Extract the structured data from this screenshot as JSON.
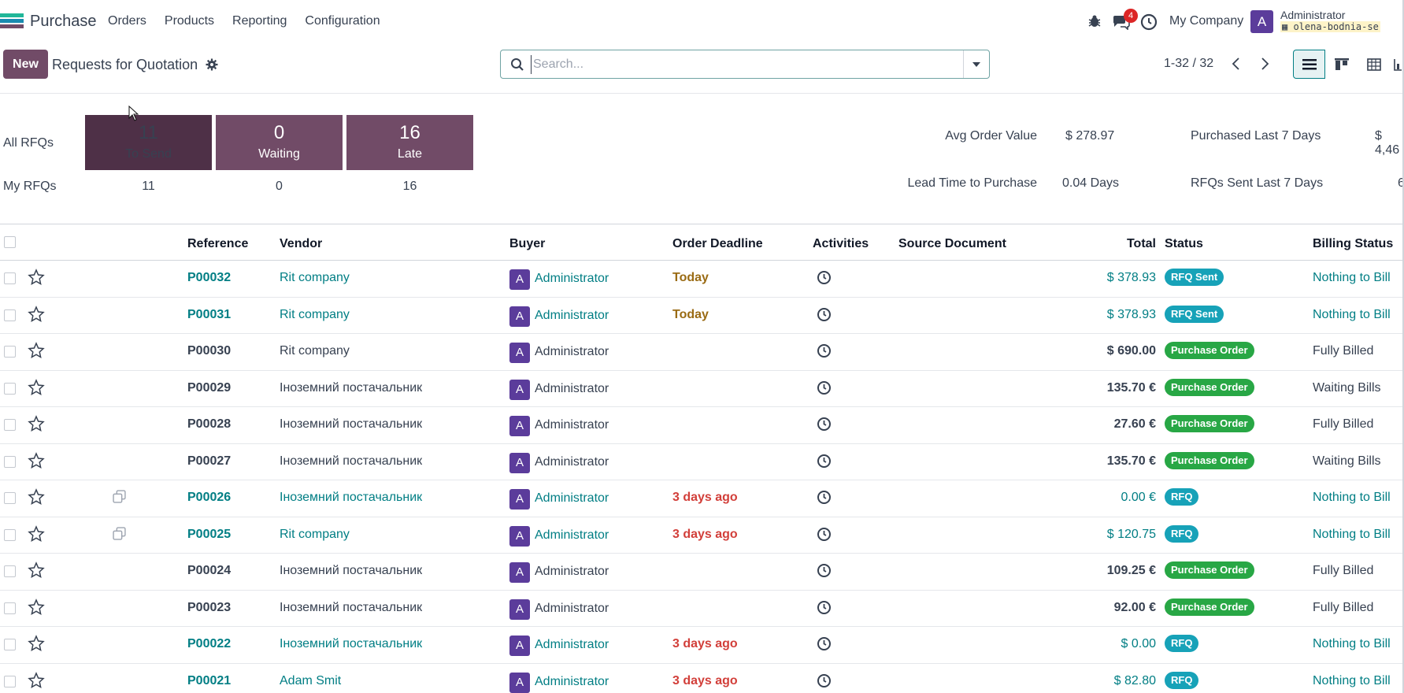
{
  "navbar": {
    "app_name": "Purchase",
    "menu": [
      "Orders",
      "Products",
      "Reporting",
      "Configuration"
    ],
    "messages_count": "4",
    "company": "My Company",
    "user_initial": "A",
    "user_name": "Administrator",
    "db_name": "olena-bodnia-se"
  },
  "control_panel": {
    "new_label": "New",
    "title": "Requests for Quotation",
    "search_placeholder": "Search...",
    "pager": "1-32 / 32"
  },
  "dashboard": {
    "all_rfqs_label": "All RFQs",
    "my_rfqs_label": "My RFQs",
    "tiles": [
      {
        "count": "11",
        "label": "To Send"
      },
      {
        "count": "0",
        "label": "Waiting"
      },
      {
        "count": "16",
        "label": "Late"
      }
    ],
    "my_counts": [
      "11",
      "0",
      "16"
    ],
    "kpis": [
      {
        "label": "Avg Order Value",
        "value": "$ 278.97"
      },
      {
        "label": "Purchased Last 7 Days",
        "value": "$ 4,46"
      },
      {
        "label": "Lead Time to Purchase",
        "value": "0.04 Days"
      },
      {
        "label": "RFQs Sent Last 7 Days",
        "value": "6"
      }
    ]
  },
  "table": {
    "columns": [
      "Reference",
      "Vendor",
      "Buyer",
      "Order Deadline",
      "Activities",
      "Source Document",
      "Total",
      "Status",
      "Billing Status"
    ],
    "rows": [
      {
        "ref": "P00032",
        "vendor": "Rit company",
        "buyer": "Administrator",
        "deadline": "Today",
        "total": "$ 378.93",
        "status": "RFQ Sent",
        "billing": "Nothing to Bill"
      },
      {
        "ref": "P00031",
        "vendor": "Rit company",
        "buyer": "Administrator",
        "deadline": "Today",
        "total": "$ 378.93",
        "status": "RFQ Sent",
        "billing": "Nothing to Bill"
      },
      {
        "ref": "P00030",
        "vendor": "Rit company",
        "buyer": "Administrator",
        "deadline": "",
        "total": "$ 690.00",
        "status": "Purchase Order",
        "billing": "Fully Billed"
      },
      {
        "ref": "P00029",
        "vendor": "Іноземний постачальник",
        "buyer": "Administrator",
        "deadline": "",
        "total": "135.70 €",
        "status": "Purchase Order",
        "billing": "Waiting Bills"
      },
      {
        "ref": "P00028",
        "vendor": "Іноземний постачальник",
        "buyer": "Administrator",
        "deadline": "",
        "total": "27.60 €",
        "status": "Purchase Order",
        "billing": "Fully Billed"
      },
      {
        "ref": "P00027",
        "vendor": "Іноземний постачальник",
        "buyer": "Administrator",
        "deadline": "",
        "total": "135.70 €",
        "status": "Purchase Order",
        "billing": "Waiting Bills"
      },
      {
        "ref": "P00026",
        "vendor": "Іноземний постачальник",
        "buyer": "Administrator",
        "deadline": "3 days ago",
        "total": "0.00 €",
        "status": "RFQ",
        "billing": "Nothing to Bill"
      },
      {
        "ref": "P00025",
        "vendor": "Rit company",
        "buyer": "Administrator",
        "deadline": "3 days ago",
        "total": "$ 120.75",
        "status": "RFQ",
        "billing": "Nothing to Bill"
      },
      {
        "ref": "P00024",
        "vendor": "Іноземний постачальник",
        "buyer": "Administrator",
        "deadline": "",
        "total": "109.25 €",
        "status": "Purchase Order",
        "billing": "Fully Billed"
      },
      {
        "ref": "P00023",
        "vendor": "Іноземний постачальник",
        "buyer": "Administrator",
        "deadline": "",
        "total": "92.00 €",
        "status": "Purchase Order",
        "billing": "Fully Billed"
      },
      {
        "ref": "P00022",
        "vendor": "Іноземний постачальник",
        "buyer": "Administrator",
        "deadline": "3 days ago",
        "total": "$ 0.00",
        "status": "RFQ",
        "billing": "Nothing to Bill"
      },
      {
        "ref": "P00021",
        "vendor": "Adam Smit",
        "buyer": "Administrator",
        "deadline": "3 days ago",
        "total": "$ 82.80",
        "status": "RFQ",
        "billing": "Nothing to Bill"
      }
    ]
  },
  "colors": {
    "brand": "#714b67",
    "link": "#017e84",
    "rfq_badge": "#17a2b8",
    "po_badge": "#28a745",
    "late": "#d23f3a",
    "today": "#9a6b14"
  }
}
